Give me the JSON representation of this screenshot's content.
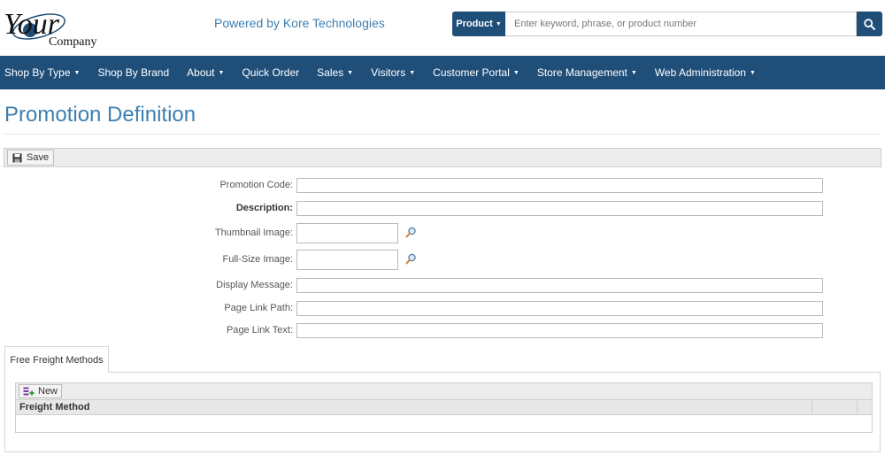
{
  "header": {
    "logo": {
      "word": "Your",
      "company": "Company"
    },
    "powered_by": "Powered by Kore Technologies",
    "search": {
      "category_label": "Product",
      "placeholder": "Enter keyword, phrase, or product number"
    }
  },
  "nav": {
    "items": [
      {
        "label": "Shop By Type",
        "dropdown": true
      },
      {
        "label": "Shop By Brand",
        "dropdown": false
      },
      {
        "label": "About",
        "dropdown": true
      },
      {
        "label": "Quick Order",
        "dropdown": false
      },
      {
        "label": "Sales",
        "dropdown": true
      },
      {
        "label": "Visitors",
        "dropdown": true
      },
      {
        "label": "Customer Portal",
        "dropdown": true
      },
      {
        "label": "Store Management",
        "dropdown": true
      },
      {
        "label": "Web Administration",
        "dropdown": true
      }
    ]
  },
  "page": {
    "title": "Promotion Definition"
  },
  "toolbar": {
    "save_label": "Save"
  },
  "form": {
    "promotion_code": {
      "label": "Promotion Code:",
      "value": ""
    },
    "description": {
      "label": "Description:",
      "value": ""
    },
    "thumbnail_image": {
      "label": "Thumbnail Image:",
      "value": ""
    },
    "full_size_image": {
      "label": "Full-Size Image:",
      "value": ""
    },
    "display_message": {
      "label": "Display Message:",
      "value": ""
    },
    "page_link_path": {
      "label": "Page Link Path:",
      "value": ""
    },
    "page_link_text": {
      "label": "Page Link Text:",
      "value": ""
    }
  },
  "tabs": [
    {
      "label": "Free Freight Methods",
      "active": true
    }
  ],
  "freight_grid": {
    "new_label": "New",
    "columns": [
      "Freight Method",
      "",
      ""
    ],
    "rows": []
  },
  "colors": {
    "brand_navy": "#1f4e79",
    "title_blue": "#3d7fb0",
    "white": "#ffffff"
  },
  "icons": {
    "search_button": "magnifier-icon",
    "save": "floppy-disk-icon",
    "lookup": "magnifier-lookup-icon",
    "new": "add-row-icon"
  }
}
